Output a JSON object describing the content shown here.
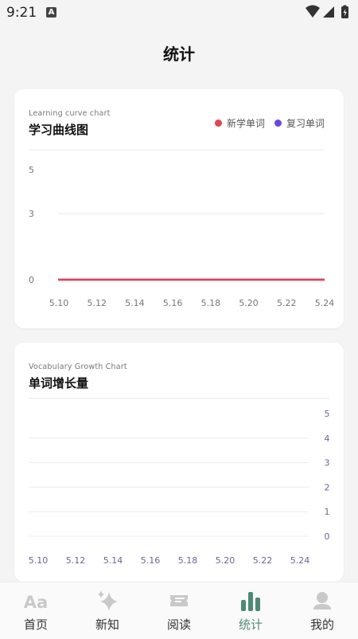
{
  "status_bar": {
    "time": "9:21",
    "notif_letter": "A"
  },
  "header": {
    "title": "统计"
  },
  "learning_card": {
    "subtitle": "Learning curve chart",
    "title": "学习曲线图",
    "legend": [
      {
        "label": "新学单词",
        "color": "#e4434f"
      },
      {
        "label": "复习单词",
        "color": "#6a45e6"
      }
    ]
  },
  "growth_card": {
    "subtitle": "Vocabulary Growth Chart",
    "title": "单词增长量"
  },
  "chart_data": [
    {
      "type": "line",
      "title": "学习曲线图",
      "x": [
        "5.10",
        "5.12",
        "5.14",
        "5.16",
        "5.18",
        "5.20",
        "5.22",
        "5.24"
      ],
      "y_ticks": [
        0,
        3,
        5
      ],
      "ylim": [
        0,
        5
      ],
      "series": [
        {
          "name": "新学单词",
          "color": "#e4434f",
          "values": [
            0,
            0,
            0,
            0,
            0,
            0,
            0,
            0
          ]
        },
        {
          "name": "复习单词",
          "color": "#6a45e6",
          "values": [
            0,
            0,
            0,
            0,
            0,
            0,
            0,
            0
          ]
        }
      ],
      "legend_position": "top-right",
      "grid": true
    },
    {
      "type": "line",
      "title": "单词增长量",
      "x": [
        "5.10",
        "5.12",
        "5.14",
        "5.16",
        "5.18",
        "5.20",
        "5.22",
        "5.24"
      ],
      "y_ticks": [
        0,
        1,
        2,
        3,
        4,
        5
      ],
      "ylim": [
        0,
        5
      ],
      "y_axis_side": "right",
      "series": [],
      "grid": true
    }
  ],
  "tabs": [
    {
      "label": "首页",
      "icon": "aa-icon",
      "active": false
    },
    {
      "label": "新知",
      "icon": "sparkle-icon",
      "active": false
    },
    {
      "label": "阅读",
      "icon": "ticket-icon",
      "active": false
    },
    {
      "label": "统计",
      "icon": "bar-chart-icon",
      "active": true
    },
    {
      "label": "我的",
      "icon": "person-icon",
      "active": false
    }
  ],
  "colors": {
    "accent": "#4e8a76",
    "tab_icon": "#c9c9c9"
  }
}
